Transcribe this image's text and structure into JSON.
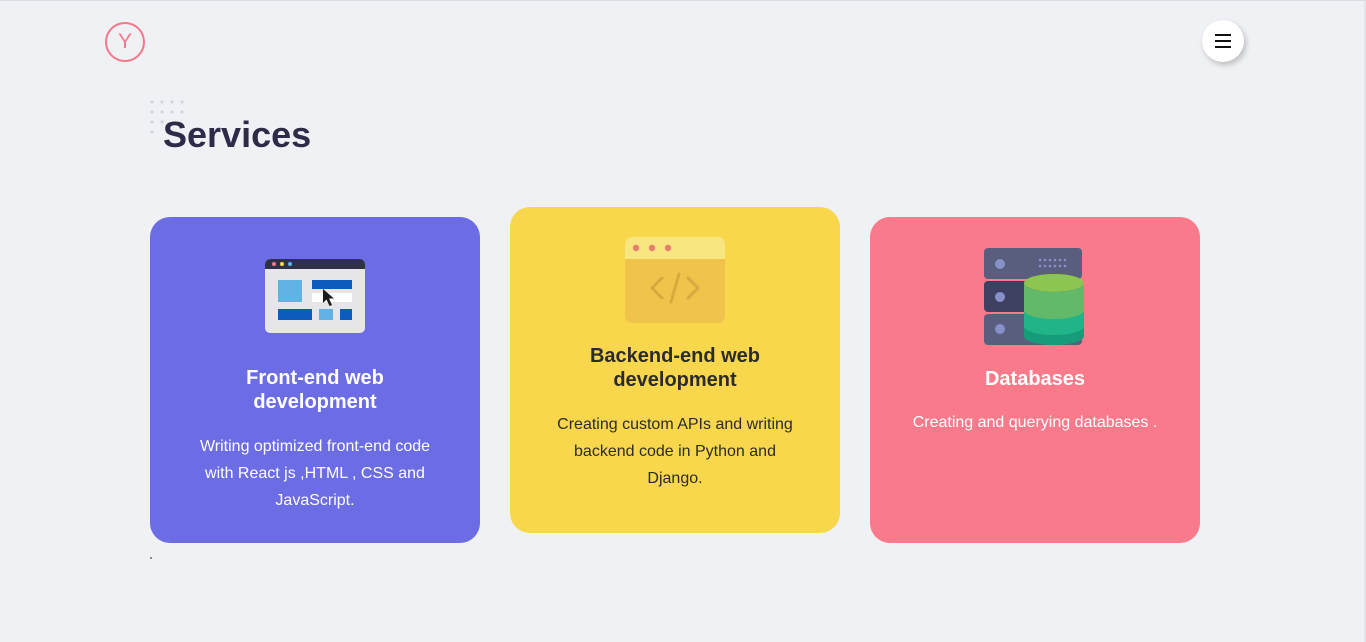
{
  "header": {
    "logo_letter": "Y",
    "menu_icon": "hamburger-icon"
  },
  "section": {
    "title": "Services"
  },
  "cards": [
    {
      "icon": "browser-window-icon",
      "title": "Front-end web development",
      "description": "Writing optimized front-end code with React js ,HTML , CSS and JavaScript.",
      "color": "#6c6ce5"
    },
    {
      "icon": "code-window-icon",
      "title": "Backend-end web development",
      "description": "Creating custom APIs and writing backend code in Python and Django.",
      "color": "#f8d74c"
    },
    {
      "icon": "database-server-icon",
      "title": "Databases",
      "description": "Creating and querying databases .",
      "color": "#f97b8b"
    }
  ],
  "colors": {
    "background": "#f0f1f5",
    "accent": "#f47789",
    "heading": "#2e2b48"
  }
}
